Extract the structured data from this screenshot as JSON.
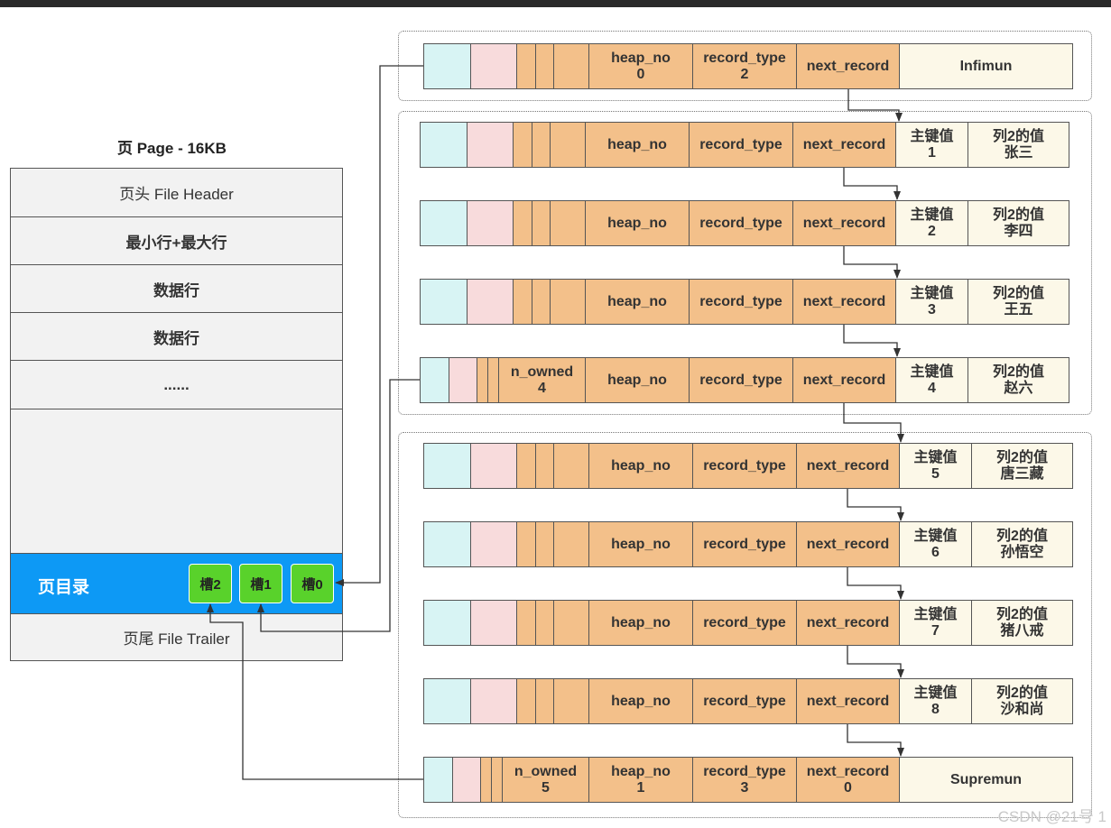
{
  "page": {
    "title": "页 Page - 16KB",
    "rows": [
      "页头 File Header",
      "最小行+最大行",
      "数据行",
      "数据行",
      "......"
    ],
    "directory": {
      "label": "页目录",
      "slots": [
        "槽2",
        "槽1",
        "槽0"
      ]
    },
    "trailer": "页尾 File Trailer"
  },
  "labels": {
    "heap_no": "heap_no",
    "record_type": "record_type",
    "next_record": "next_record",
    "n_owned": "n_owned",
    "key": "主键值",
    "col2": "列2的值"
  },
  "infimum": {
    "heap_no": "0",
    "record_type": "2",
    "name": "Infimun"
  },
  "supremum": {
    "n_owned": "5",
    "heap_no": "1",
    "record_type": "3",
    "next_record": "0",
    "name": "Supremun"
  },
  "records": [
    {
      "key": "1",
      "col2": "张三"
    },
    {
      "key": "2",
      "col2": "李四"
    },
    {
      "key": "3",
      "col2": "王五"
    },
    {
      "key": "4",
      "col2": "赵六",
      "n_owned": "4"
    },
    {
      "key": "5",
      "col2": "唐三藏"
    },
    {
      "key": "6",
      "col2": "孙悟空"
    },
    {
      "key": "7",
      "col2": "猪八戒"
    },
    {
      "key": "8",
      "col2": "沙和尚"
    }
  ],
  "watermark": "CSDN @21号       1",
  "colors": {
    "cyan": "#d8f4f4",
    "pink": "#f8dbdc",
    "orange": "#f3c08a",
    "cream": "#fcf8e8",
    "directory": "#0d99f5",
    "slot": "#59d22b"
  }
}
